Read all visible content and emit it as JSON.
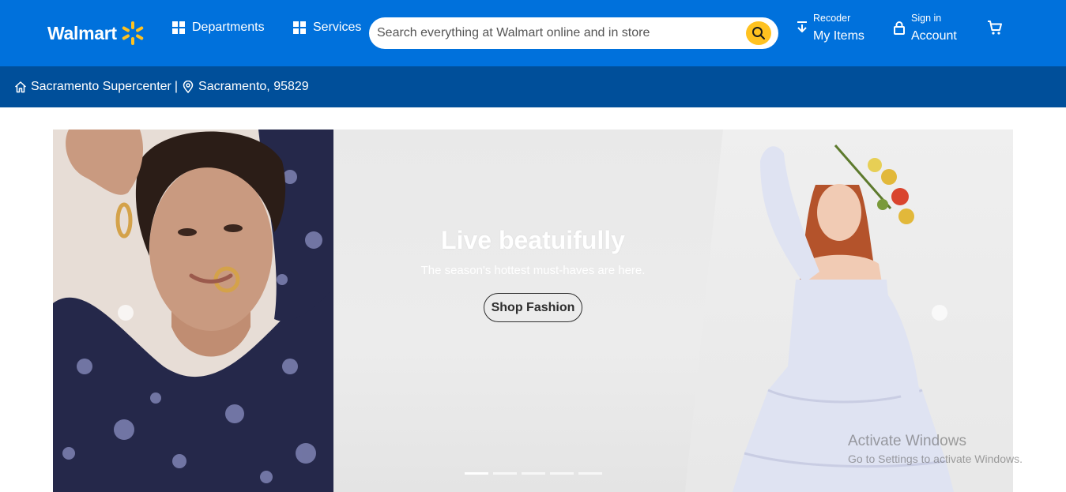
{
  "header": {
    "logo_text": "Walmart",
    "departments_label": "Departments",
    "services_label": "Services",
    "search": {
      "placeholder": "Search everything at Walmart online and in store"
    },
    "reorder": {
      "small": "Recoder",
      "big": "My Items"
    },
    "account": {
      "small": "Sign in",
      "big": "Account"
    },
    "colors": {
      "primary": "#0071dc",
      "secondary": "#004f9a",
      "accent": "#ffc220"
    }
  },
  "subbar": {
    "store": "Sacramento Supercenter",
    "separator": "|",
    "location": "Sacramento, 95829"
  },
  "hero": {
    "title": "Live beatuifully",
    "subtitle": "The season's hottest must-haves are here.",
    "cta_label": "Shop Fashion",
    "slide_count": 5,
    "active_slide": 1
  },
  "watermark": {
    "line1": "Activate Windows",
    "line2": "Go to Settings to activate Windows."
  }
}
